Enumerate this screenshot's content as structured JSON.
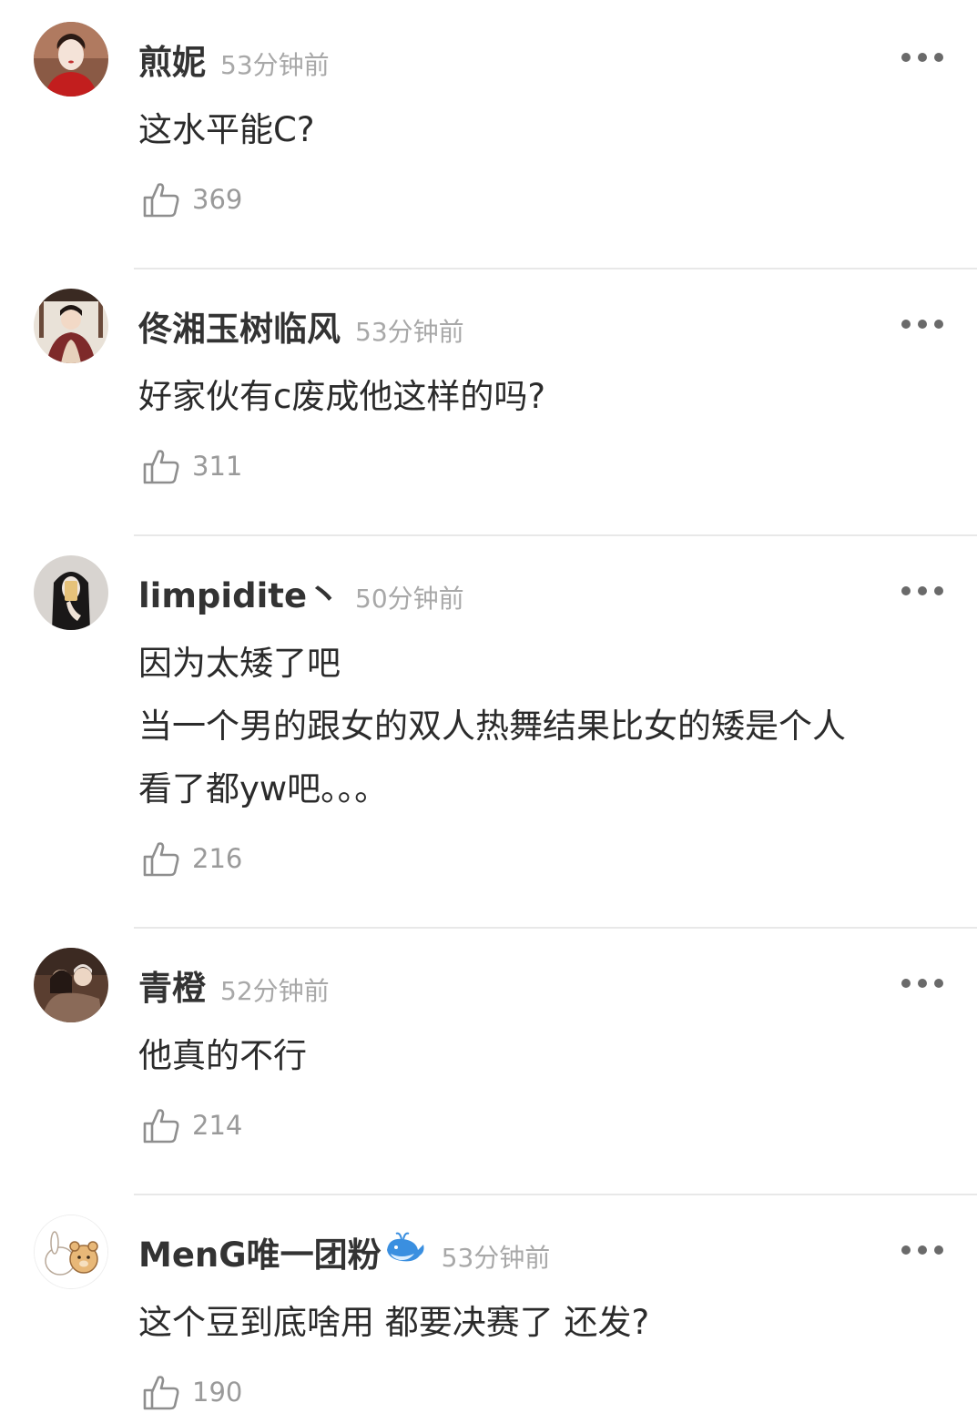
{
  "comments": [
    {
      "username": "煎妮",
      "time": "53分钟前",
      "text": [
        "这水平能C?"
      ],
      "likes": "369",
      "avatar": "woman-red-avatar"
    },
    {
      "username": "佟湘玉树临风",
      "time": "53分钟前",
      "text": [
        "好家伙有c废成他这样的吗?"
      ],
      "likes": "311",
      "avatar": "illustration-avatar"
    },
    {
      "username": "limpidite丶",
      "time": "50分钟前",
      "text": [
        "因为太矮了吧",
        "当一个男的跟女的双人热舞结果比女的矮是个人",
        "看了都yw吧。。。"
      ],
      "likes": "216",
      "avatar": "mirror-selfie-avatar"
    },
    {
      "username": "青橙",
      "time": "52分钟前",
      "text": [
        "他真的不行"
      ],
      "likes": "214",
      "avatar": "couple-photo-avatar"
    },
    {
      "username": "MenG唯一团粉",
      "time": "53分钟前",
      "text": [
        "这个豆到底啥用 都要决赛了 还发?"
      ],
      "likes": "190",
      "avatar": "cartoon-bear-rabbit-avatar",
      "badge": "whale-icon"
    }
  ],
  "colors": {
    "username": "#333333",
    "time": "#a8a8a8",
    "text": "#2b2b2b",
    "likes": "#9a9a9a",
    "divider": "#e8e8e8",
    "badge": "#3a8fe0"
  }
}
